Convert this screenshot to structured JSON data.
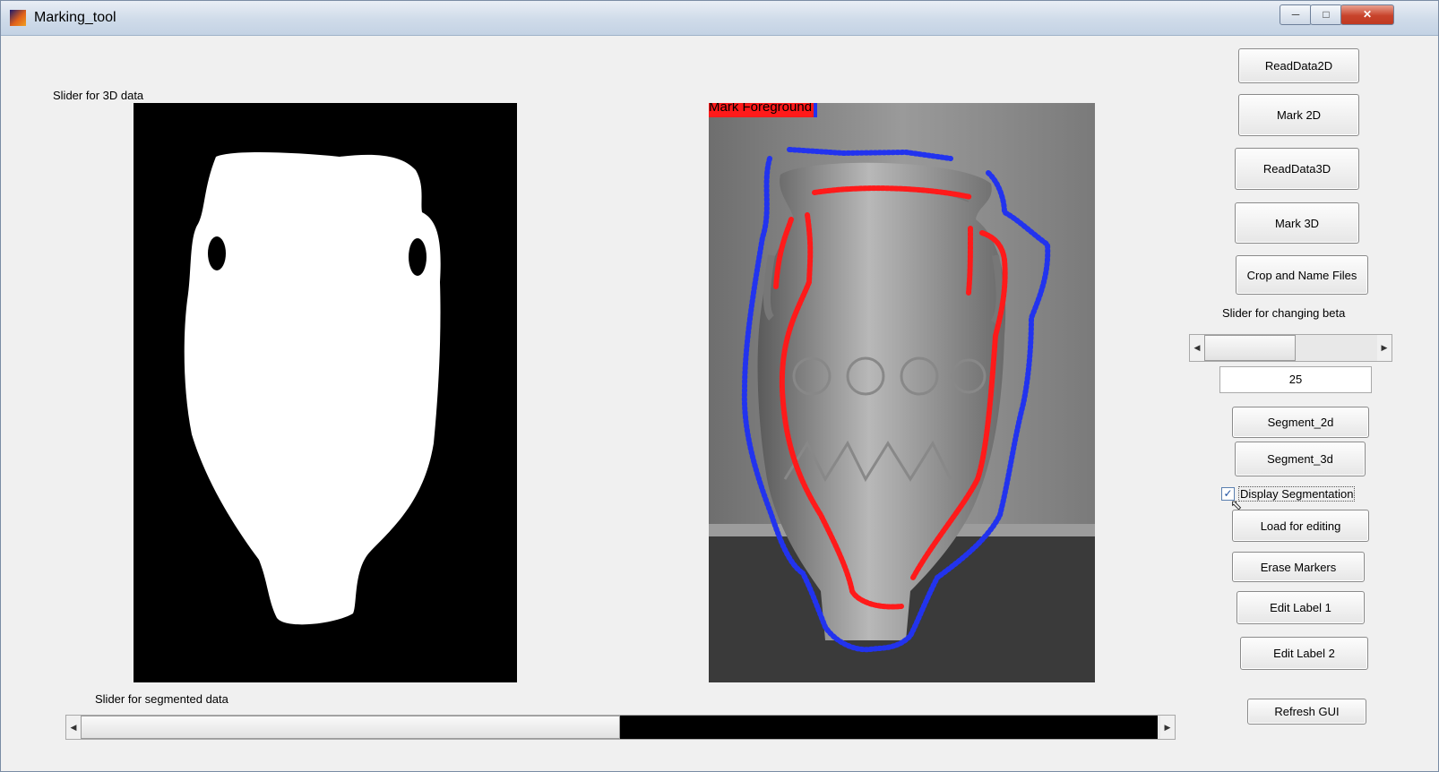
{
  "window": {
    "title": "Marking_tool"
  },
  "labels": {
    "slider_3d": "Slider for 3D data",
    "slider_segmented": "Slider for segmented data",
    "slider_beta": "Slider for changing beta"
  },
  "overlay": {
    "mark_label": "Mark Foreground"
  },
  "buttons": {
    "read_2d": "ReadData2D",
    "mark_2d": "Mark 2D",
    "read_3d": "ReadData3D",
    "mark_3d": "Mark 3D",
    "crop_name": "Crop and Name Files",
    "segment_2d": "Segment_2d",
    "segment_3d": "Segment_3d",
    "load_editing": "Load for editing",
    "erase_markers": "Erase Markers",
    "edit_label_1": "Edit Label 1",
    "edit_label_2": "Edit Label 2",
    "refresh": "Refresh GUI"
  },
  "beta": {
    "value": "25",
    "slider_fraction": 0.55
  },
  "checkbox": {
    "label": "Display Segmentation",
    "checked": true
  },
  "segmented_slider": {
    "fraction": 0.5
  },
  "colors": {
    "foreground_marker": "#ff1a1a",
    "background_marker": "#2233ee"
  },
  "icons": {
    "min": "minimize-icon",
    "max": "maximize-icon",
    "close": "close-icon"
  }
}
